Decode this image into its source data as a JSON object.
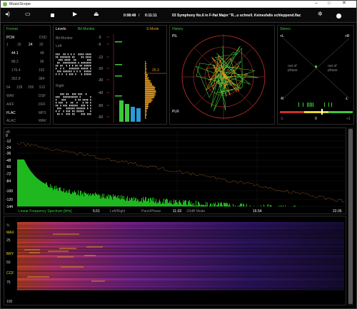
{
  "window": {
    "title": "MusicScope"
  },
  "toolbar": {
    "time_elapsed": "0:08:48",
    "time_sep": "/",
    "time_total": "0:11:11",
    "track": "03 Symphony No.6 in F-flat Major \"R...u schnell. Keinesfalls schleppend.flac"
  },
  "format": {
    "title": "Format",
    "row1": [
      "PCM",
      "DSD"
    ],
    "row2": [
      "1",
      "16",
      "24",
      "32"
    ],
    "rates_left": [
      "44.1",
      "88.2",
      "176.4",
      "352.8"
    ],
    "rates_right": [
      "48",
      "96",
      "192",
      "384"
    ],
    "dsd_rates": [
      "64",
      "128",
      "256",
      "512"
    ],
    "codecs_left": [
      "WAV",
      "AIFF",
      "FLAC",
      "ALAC"
    ],
    "codecs_right": [
      "DSF",
      "DFF",
      "MP3",
      "WAV"
    ]
  },
  "levels": {
    "title": "Levels",
    "mode": "Bit Monitor",
    "sub": "Bit Monitor",
    "left": "Left",
    "right": "Right"
  },
  "smode": {
    "label": "S-Mode",
    "ticks": [
      "-3",
      "-6",
      "-12",
      "-20",
      "-30",
      "-40",
      "-50",
      "-60"
    ],
    "value": "25.3"
  },
  "history": {
    "title": "History",
    "pl": "PlL",
    "plr": "PLR"
  },
  "stereo": {
    "title": "Stereo",
    "l": "+L",
    "r": "+R",
    "nl": "-L",
    "nr": "-R",
    "out_left": "out of phase",
    "out_right": "out of phase",
    "corr_low": "-1",
    "corr_mid": "0",
    "corr_high": "+1"
  },
  "spectrum": {
    "db_label": "dB",
    "db_ticks": [
      "0",
      "-12",
      "-24",
      "-36",
      "-48",
      "-60",
      "-72",
      "-84",
      "-100",
      "-120",
      "-144"
    ],
    "xlabel": "Linear Frequency Spectrum [kHz]",
    "mode1": "Left/Right",
    "mode2": "Pano/Phase",
    "mode3": "-20dB Mode",
    "x_ticks": [
      "5.51",
      "11.03",
      "16.54",
      "22.05"
    ]
  },
  "spectrogram": {
    "pct": "%",
    "rows": [
      "MAX",
      "25",
      "BRY",
      "50",
      "CCF",
      "75",
      "100"
    ]
  }
}
